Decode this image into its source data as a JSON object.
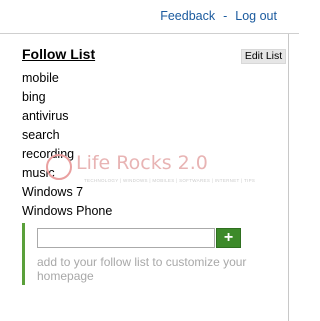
{
  "header": {
    "feedback_label": "Feedback",
    "separator": "-",
    "logout_label": "Log out"
  },
  "follow_list": {
    "title": "Follow List",
    "edit_label": "Edit List",
    "items": [
      "mobile",
      "bing",
      "antivirus",
      "search",
      "recording",
      "music",
      "Windows 7",
      "Windows Phone"
    ],
    "add_input_value": "",
    "add_button_label": "+",
    "hint": "add to your follow list to customize your homepage"
  },
  "watermark": {
    "brand": "Life Rocks 2.0",
    "tagline": "TECHNOLOGY | WINDOWS | MOBILES | SOFTWARES | INTERNET | TIPS"
  },
  "colors": {
    "link": "#1a5a9e",
    "accent_green": "#3d8a2a",
    "hint_gray": "#a8a8a8"
  }
}
